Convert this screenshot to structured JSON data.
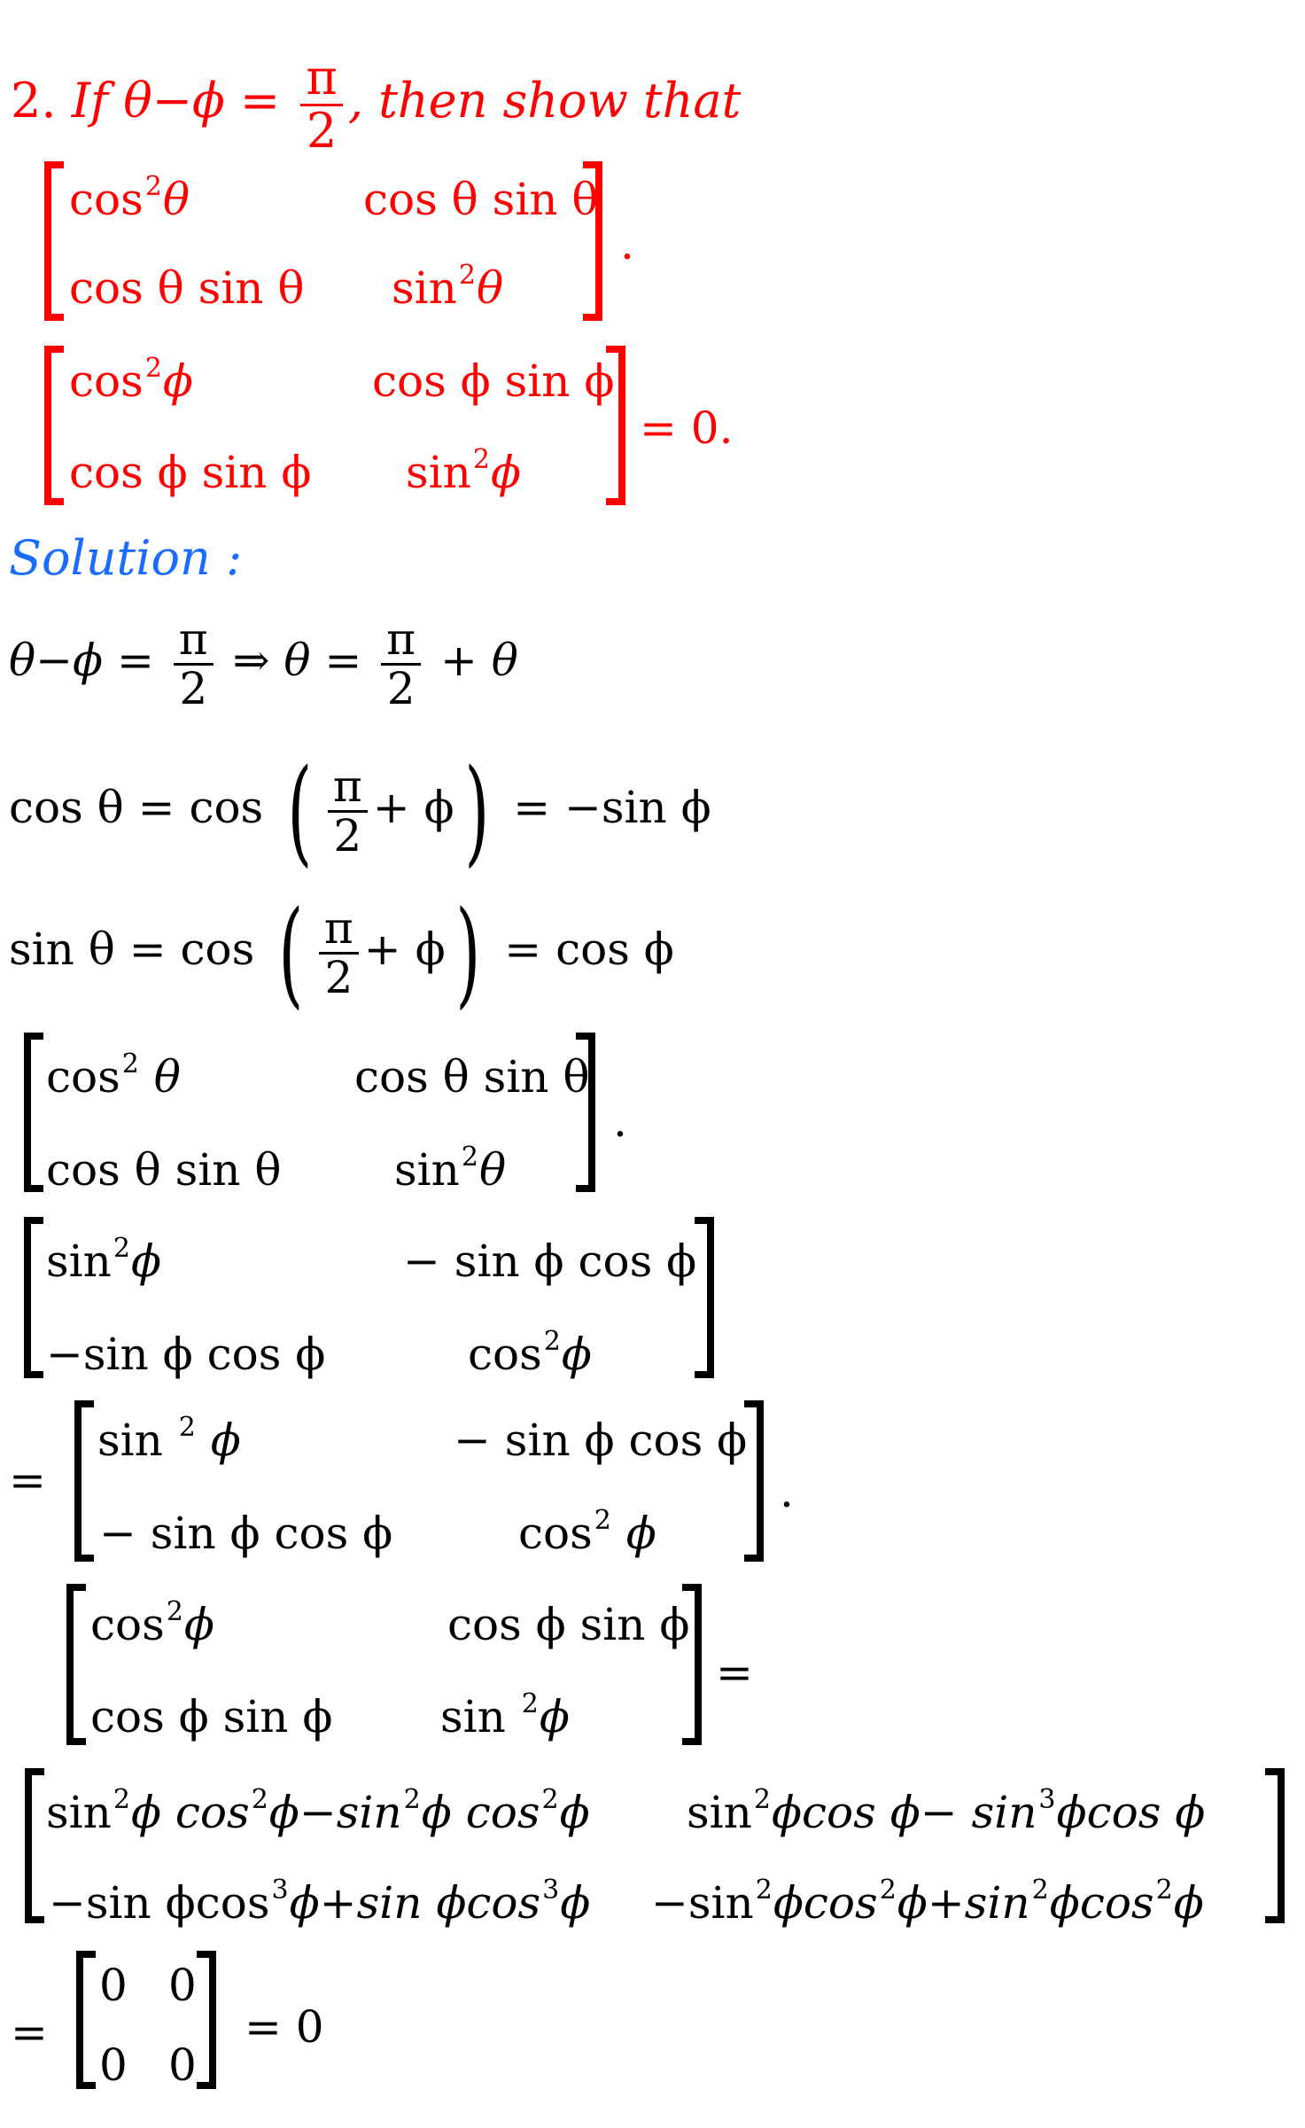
{
  "problem": {
    "number": "2.",
    "if": "If",
    "lhs": "θ−ϕ =",
    "frac_num": "π",
    "frac_den": "2",
    "tail": ", then show that",
    "matrix1": {
      "r1c1": "cos",
      "r1c1_sup": "2",
      "r1c1_var": "θ",
      "r1c2": "cos θ sin θ",
      "r2c1": "cos θ sin θ",
      "r2c2": "sin",
      "r2c2_sup": "2",
      "r2c2_var": "θ",
      "after": "."
    },
    "matrix2": {
      "r1c1": "cos",
      "r1c1_sup": "2",
      "r1c1_var": "ϕ",
      "r1c2": "cos ϕ sin ϕ",
      "r2c1": "cos ϕ sin ϕ",
      "r2c2": "sin",
      "r2c2_sup": "2",
      "r2c2_var": "ϕ",
      "after": "= 0."
    }
  },
  "solution": {
    "heading": "Solution :",
    "line1": {
      "lhs": "θ−ϕ =",
      "num": "π",
      "den": "2",
      "mid": "⇒ θ =",
      "num2": "π",
      "den2": "2",
      "tail": "+ θ"
    },
    "line2": {
      "lhs": "cos θ = cos",
      "num": "π",
      "den": "2",
      "inner": "+ ϕ",
      "tail": "= −sin ϕ"
    },
    "line3": {
      "lhs": "sin  θ = cos",
      "num": "π",
      "den": "2",
      "inner": "+ ϕ",
      "tail": "= cos ϕ"
    },
    "matrix3": {
      "r1c1": "cos",
      "r1c1_sup": "2",
      "r1c1_var": " θ",
      "r1c2": "cos θ sin θ",
      "r2c1": "cos θ sin θ",
      "r2c2": "sin",
      "r2c2_sup": "2",
      "r2c2_var": "θ",
      "after": "."
    },
    "matrix4": {
      "r1c1": "sin",
      "r1c1_sup": "2",
      "r1c1_var": "ϕ",
      "r1c2": "− sin ϕ cos ϕ",
      "r2c1": "−sin ϕ cos ϕ",
      "r2c2": "cos",
      "r2c2_sup": "2",
      "r2c2_var": "ϕ"
    },
    "matrix5": {
      "before": "=",
      "r1c1": "sin ",
      "r1c1_sup": "2",
      "r1c1_var": " ϕ",
      "r1c2": "− sin ϕ cos ϕ",
      "r2c1": "− sin ϕ cos ϕ",
      "r2c2": "cos",
      "r2c2_sup": "2",
      "r2c2_var": " ϕ",
      "after": "."
    },
    "matrix6": {
      "r1c1": "cos",
      "r1c1_sup": "2",
      "r1c1_var": "ϕ",
      "r1c2": "cos ϕ sin ϕ",
      "r2c1": "cos ϕ sin ϕ",
      "r2c2": "sin ",
      "r2c2_sup": "2",
      "r2c2_var": "ϕ",
      "after": "="
    },
    "matrix7": {
      "r1c1": [
        "sin",
        "2",
        "ϕ cos",
        "2",
        "ϕ−sin",
        "2",
        "ϕ cos",
        "2",
        "ϕ"
      ],
      "r1c2": [
        "sin",
        "2",
        "ϕcos ϕ− sin",
        "3",
        "ϕcos ϕ"
      ],
      "r2c1": [
        "−sin ϕcos",
        "3",
        "ϕ+sin ϕcos",
        "3",
        "ϕ"
      ],
      "r2c2": [
        "−sin",
        "2",
        "ϕcos",
        "2",
        "ϕ+sin",
        "2",
        "ϕcos",
        "2",
        "ϕ"
      ]
    },
    "final": {
      "before": "=",
      "cells": [
        "0",
        "0",
        "0",
        "0"
      ],
      "after": "= 0"
    }
  },
  "colors": {
    "problem": "#ff0000",
    "heading": "#1a6cff",
    "body": "#000000"
  }
}
